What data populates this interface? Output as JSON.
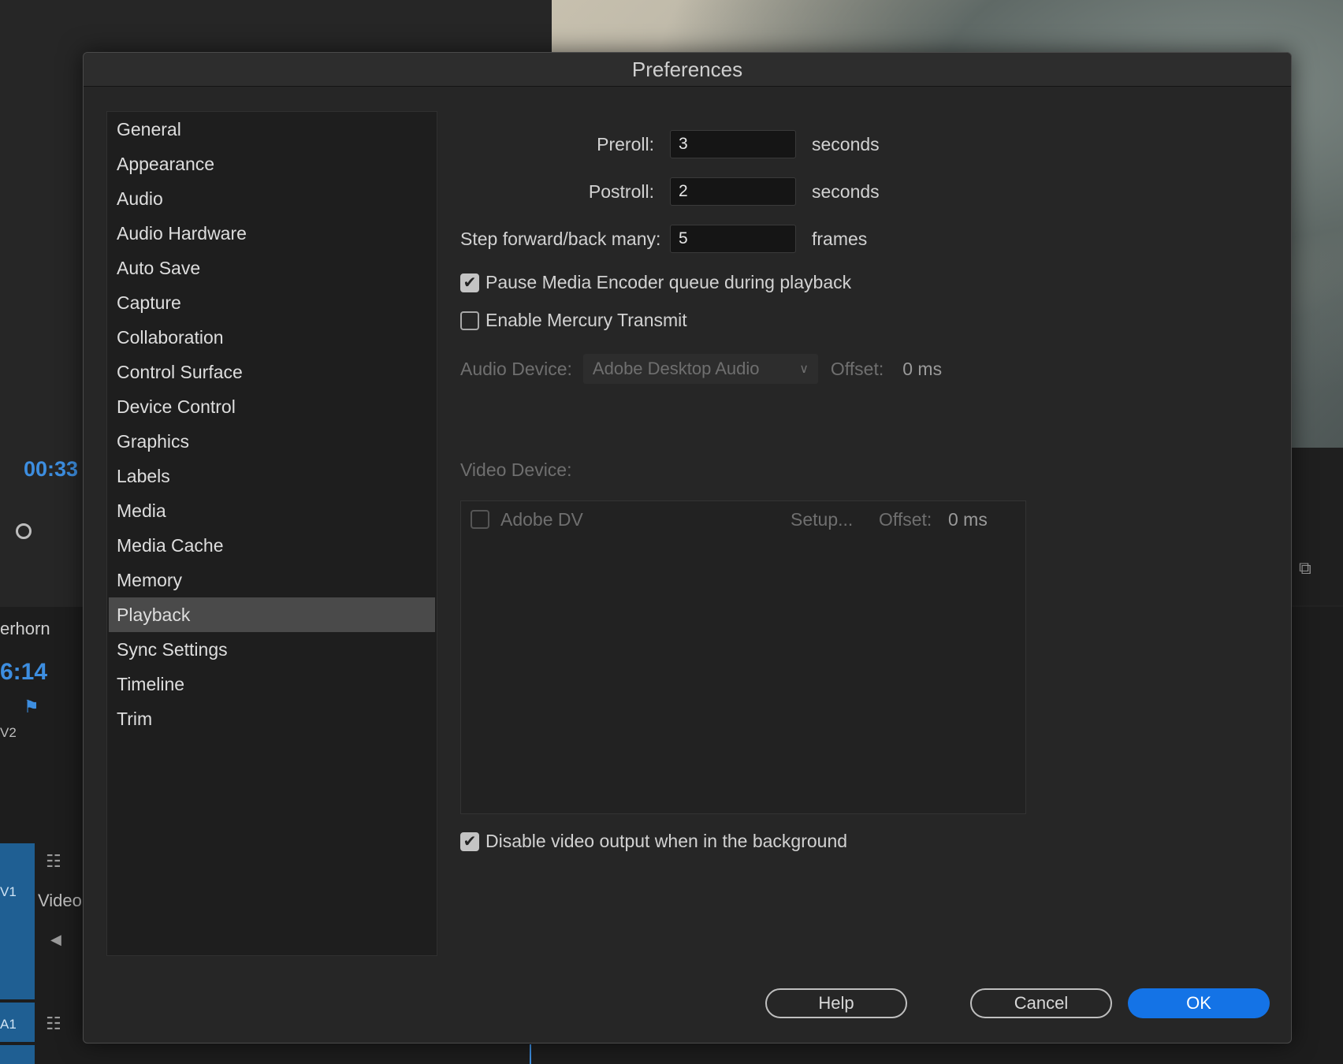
{
  "background": {
    "timecode_top": "00:33",
    "sequence_name": "erhorn",
    "timecode_bottom": "6:14",
    "track_v2": "V2",
    "track_v1": "V1",
    "track_a1": "A1",
    "video_label": "Video"
  },
  "dialog": {
    "title": "Preferences",
    "categories": [
      "General",
      "Appearance",
      "Audio",
      "Audio Hardware",
      "Auto Save",
      "Capture",
      "Collaboration",
      "Control Surface",
      "Device Control",
      "Graphics",
      "Labels",
      "Media",
      "Media Cache",
      "Memory",
      "Playback",
      "Sync Settings",
      "Timeline",
      "Trim"
    ],
    "selected_category": "Playback",
    "playback": {
      "preroll": {
        "label": "Preroll:",
        "value": "3",
        "unit": "seconds"
      },
      "postroll": {
        "label": "Postroll:",
        "value": "2",
        "unit": "seconds"
      },
      "step": {
        "label": "Step forward/back many:",
        "value": "5",
        "unit": "frames"
      },
      "pause_encoder": {
        "label": "Pause Media Encoder queue during playback",
        "checked": true
      },
      "mercury": {
        "label": "Enable Mercury Transmit",
        "checked": false
      },
      "audio_device": {
        "label": "Audio Device:",
        "value": "Adobe Desktop Audio",
        "offset_label": "Offset:",
        "offset_value": "0 ms"
      },
      "video_device": {
        "label": "Video Device:",
        "devices": [
          {
            "name": "Adobe DV",
            "checked": false,
            "setup": "Setup...",
            "offset_label": "Offset:",
            "offset_value": "0 ms"
          }
        ]
      },
      "disable_bg": {
        "label": "Disable video output when in the background",
        "checked": true
      }
    },
    "buttons": {
      "help": "Help",
      "cancel": "Cancel",
      "ok": "OK"
    },
    "accent_color": "#1473e6"
  }
}
